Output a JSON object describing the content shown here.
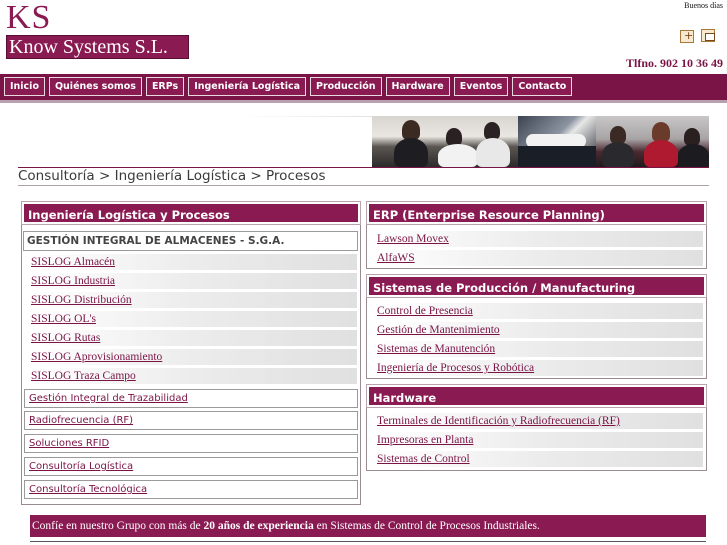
{
  "header": {
    "logo_letters": "KS",
    "company_name": "Know Systems S.L.",
    "greeting": "Buenos días",
    "phone": "Tlfno. 902 10 36 49",
    "icons": [
      "add-favorite-icon",
      "contact-icon"
    ]
  },
  "nav": {
    "items": [
      "Inicio",
      "Quiénes somos",
      "ERPs",
      "Ingeniería Logística",
      "Producción",
      "Hardware",
      "Eventos",
      "Contacto"
    ]
  },
  "breadcrumb": "Consultoría > Ingeniería Logística > Procesos",
  "left_panel": {
    "title": "Ingeniería Logística y Procesos",
    "sub_title": "GESTIÓN INTEGRAL DE ALMACENES - S.G.A.",
    "sub_items": [
      "SISLOG Almacén",
      "SISLOG Industria",
      "SISLOG Distribución",
      "SISLOG OL's",
      "SISLOG Rutas",
      "SISLOG Aprovisionamiento",
      "SISLOG Traza Campo"
    ],
    "links": [
      "Gestión Integral de Trazabilidad",
      "Radiofrecuencia (RF)",
      "Soluciones RFID",
      "Consultoría Logística",
      "Consultoría Tecnológica"
    ]
  },
  "erp_panel": {
    "title": "ERP (Enterprise Resource Planning)",
    "items": [
      "Lawson Movex",
      "AlfaWS"
    ]
  },
  "production_panel": {
    "title": "Sistemas de Producción / Manufacturing",
    "items": [
      "Control de Presencia",
      "Gestión de Mantenimiento",
      "Sistemas de Manutención",
      "Ingeniería de Procesos y Robótica"
    ]
  },
  "hardware_panel": {
    "title": "Hardware",
    "items": [
      "Terminales de Identificación y Radiofrecuencia (RF)",
      "Impresoras en Planta",
      "Sistemas de Control"
    ]
  },
  "footer": {
    "text_before": "Confíe en nuestro Grupo con más de ",
    "text_bold": "20 años de experiencia",
    "text_after": " en Sistemas de Control de Procesos Industriales."
  },
  "colors": {
    "brand": "#8a1a52",
    "brand_dark": "#7a1446",
    "link": "#7a1446"
  }
}
